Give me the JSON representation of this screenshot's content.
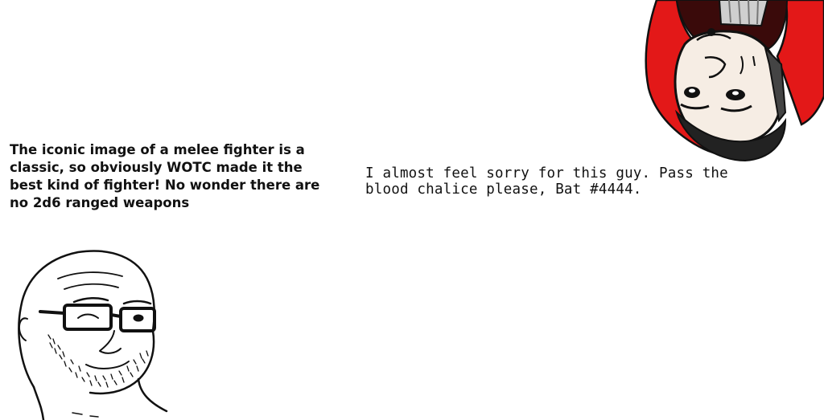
{
  "left_caption": "The iconic image of a melee fighter is a classic, so obviously WOTC made it the best kind of fighter! No wonder there are no 2d6 ranged weapons",
  "right_caption": "I almost feel sorry for this guy. Pass the blood chalice please, Bat #4444.",
  "icons": {
    "left_character": "bespectacled-wojak-icon",
    "right_character": "upside-down-vampire-icon"
  },
  "colors": {
    "cape_red": "#e31818",
    "cape_dark": "#3a0a0a",
    "hair_gray": "#cfcfcf",
    "skin": "#f6ede4"
  }
}
